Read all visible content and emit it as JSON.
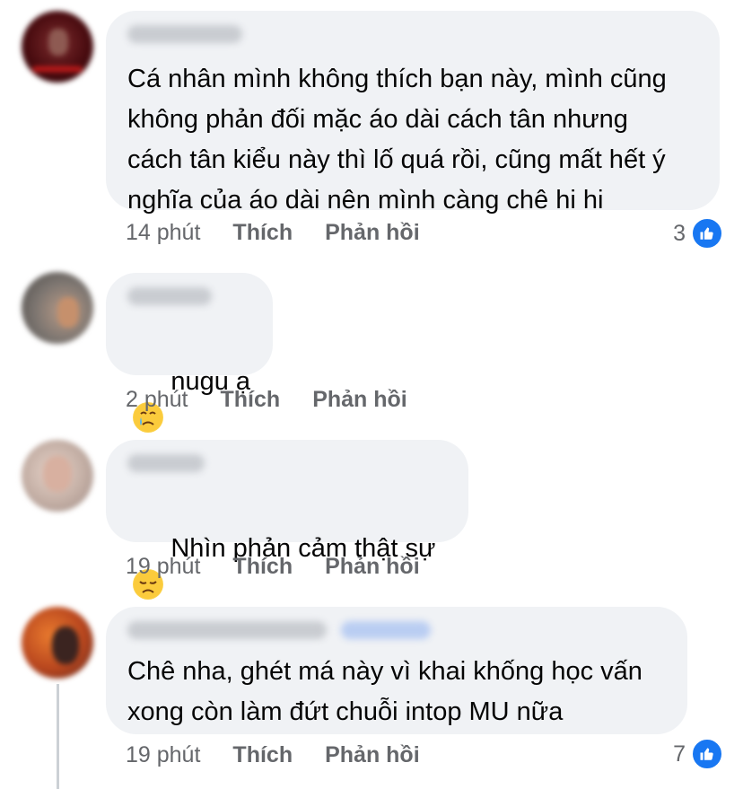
{
  "comments": [
    {
      "text": "Cá nhân mình không thích bạn này, mình cũng\nkhông phản đối mặc áo dài cách tân nhưng\ncách tân kiểu này thì lố quá rồi, cũng mất hết ý\nnghĩa của áo dài nên mình càng chê hi hi",
      "time": "14 phút",
      "like_label": "Thích",
      "reply_label": "Phản hồi",
      "reaction_count": "3",
      "avatar_color": "#5a1014"
    },
    {
      "text": "nugu ạ",
      "time": "2 phút",
      "like_label": "Thích",
      "reply_label": "Phản hồi",
      "emoji": "crying-face",
      "avatar_color": "#8c8a86"
    },
    {
      "text": "Nhìn phản cảm thật sự",
      "time": "19 phút",
      "like_label": "Thích",
      "reply_label": "Phản hồi",
      "emoji": "disappointed-face",
      "avatar_color": "#c9b6ad"
    },
    {
      "text": "Chê nha, ghét má này vì khai khống học vấn\nxong còn làm đứt chuỗi intop MU nữa",
      "time": "19 phút",
      "like_label": "Thích",
      "reply_label": "Phản hồi",
      "reaction_count": "7",
      "avatar_color": "#c8642a"
    }
  ],
  "colors": {
    "bubble": "#f0f2f5",
    "meta_text": "#65676b",
    "like_blue": "#1877f2"
  }
}
